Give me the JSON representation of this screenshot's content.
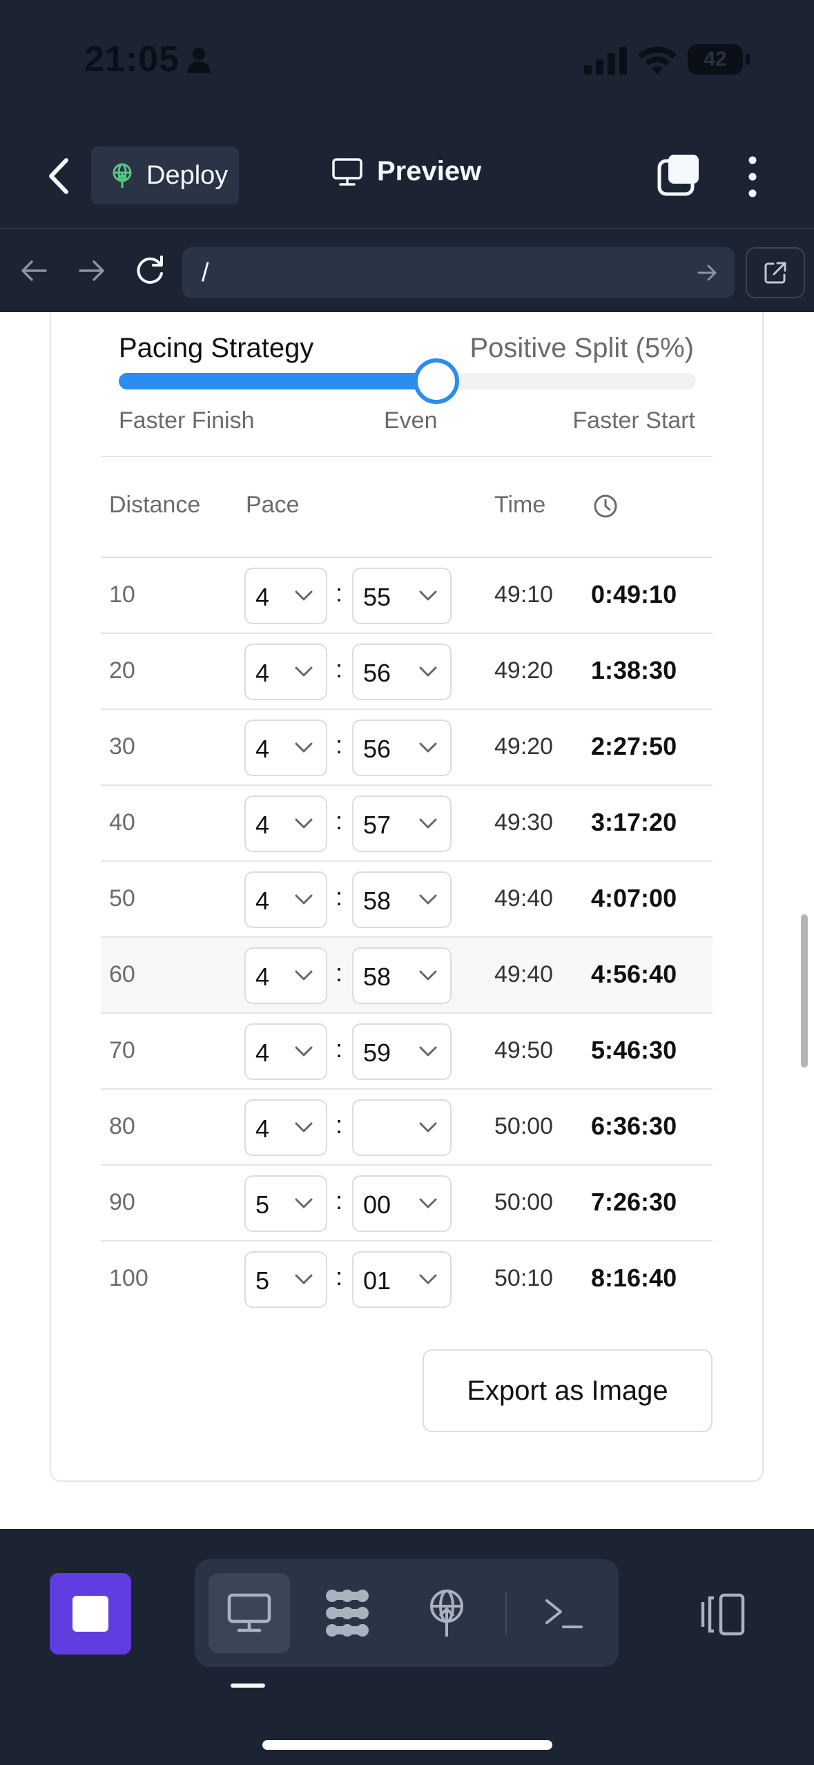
{
  "status_bar": {
    "time": "21:05",
    "battery": "42"
  },
  "toolbar": {
    "deploy_label": "Deploy",
    "preview_label": "Preview"
  },
  "url_bar": {
    "url": "/"
  },
  "pacing": {
    "title": "Pacing Strategy",
    "value": "Positive Split (5%)",
    "slider_position": 0.55,
    "labels": {
      "left": "Faster Finish",
      "center": "Even",
      "right": "Faster Start"
    }
  },
  "table": {
    "headers": {
      "distance": "Distance",
      "pace": "Pace",
      "time": "Time"
    },
    "rows": [
      {
        "distance": "10",
        "min": "4",
        "sec": "55",
        "split": "49:10",
        "cumulative": "0:49:10"
      },
      {
        "distance": "20",
        "min": "4",
        "sec": "56",
        "split": "49:20",
        "cumulative": "1:38:30"
      },
      {
        "distance": "30",
        "min": "4",
        "sec": "56",
        "split": "49:20",
        "cumulative": "2:27:50"
      },
      {
        "distance": "40",
        "min": "4",
        "sec": "57",
        "split": "49:30",
        "cumulative": "3:17:20"
      },
      {
        "distance": "50",
        "min": "4",
        "sec": "58",
        "split": "49:40",
        "cumulative": "4:07:00"
      },
      {
        "distance": "60",
        "min": "4",
        "sec": "58",
        "split": "49:40",
        "cumulative": "4:56:40"
      },
      {
        "distance": "70",
        "min": "4",
        "sec": "59",
        "split": "49:50",
        "cumulative": "5:46:30"
      },
      {
        "distance": "80",
        "min": "4",
        "sec": "",
        "split": "50:00",
        "cumulative": "6:36:30"
      },
      {
        "distance": "90",
        "min": "5",
        "sec": "00",
        "split": "50:00",
        "cumulative": "7:26:30"
      },
      {
        "distance": "100",
        "min": "5",
        "sec": "01",
        "split": "50:10",
        "cumulative": "8:16:40"
      }
    ],
    "colon": ":"
  },
  "export_label": "Export as Image",
  "colors": {
    "accent": "#2a8def",
    "stop_button": "#5f3de0",
    "chrome": "#1c2333",
    "chrome_raised": "#2b3346"
  },
  "icons": {
    "toolbar": [
      "chevron-left-icon",
      "deploy-globe-icon",
      "monitor-icon",
      "tabs-icon",
      "kebab-icon"
    ],
    "url_bar": [
      "arrow-left-icon",
      "arrow-right-icon",
      "reload-icon",
      "go-arrow-icon",
      "open-external-icon"
    ],
    "dock": [
      "stop-icon",
      "monitor-icon",
      "grid-icon",
      "deploy-globe-icon",
      "terminal-icon",
      "panel-icon"
    ]
  }
}
